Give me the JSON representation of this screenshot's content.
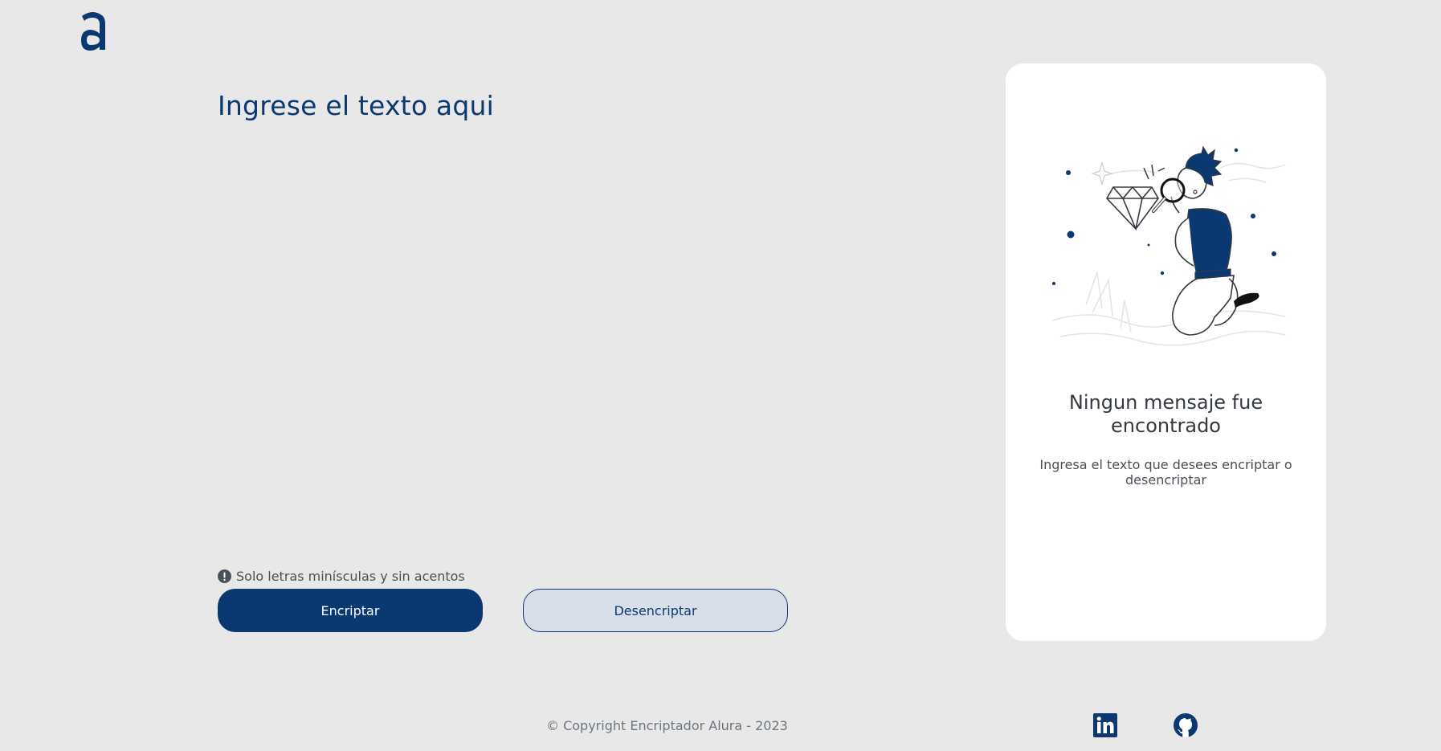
{
  "brand": {
    "logo_icon": "alura-a-logo",
    "color": "#0a3871"
  },
  "input": {
    "title": "Ingrese el texto aqui",
    "value": "",
    "hint": "Solo letras minísculas y sin acentos",
    "hint_icon": "exclamation-circle-icon"
  },
  "buttons": {
    "encrypt_label": "Encriptar",
    "decrypt_label": "Desencriptar"
  },
  "output": {
    "illustration": "person-with-magnifying-glass",
    "title": "Ningun mensaje fue encontrado",
    "text": "Ingresa el texto que desees encriptar o desencriptar"
  },
  "footer": {
    "copyright": "© Copyright Encriptador Alura - 2023",
    "linkedin_icon": "linkedin-icon",
    "github_icon": "github-icon"
  },
  "colors": {
    "background": "#e8e8e8",
    "primary": "#0a3871",
    "secondary_button": "#d8dfe8",
    "card": "#ffffff"
  }
}
